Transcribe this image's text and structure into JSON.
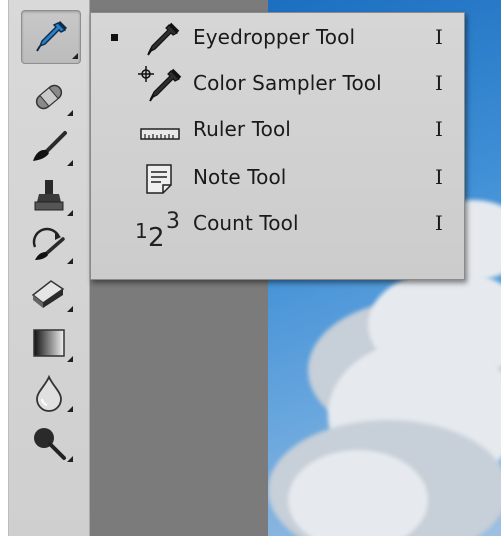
{
  "toolbar": {
    "tools": [
      {
        "name": "eyedropper-icon",
        "active": true
      },
      {
        "name": "healing-brush-icon"
      },
      {
        "name": "brush-icon"
      },
      {
        "name": "clone-stamp-icon"
      },
      {
        "name": "history-brush-icon"
      },
      {
        "name": "eraser-icon"
      },
      {
        "name": "gradient-icon"
      },
      {
        "name": "blur-drop-icon"
      },
      {
        "name": "dodge-icon"
      }
    ]
  },
  "flyout": {
    "items": [
      {
        "label": "Eyedropper Tool",
        "shortcut": "I",
        "selected": true,
        "icon": "eyedropper-icon"
      },
      {
        "label": "Color Sampler Tool",
        "shortcut": "I",
        "selected": false,
        "icon": "color-sampler-icon"
      },
      {
        "label": "Ruler Tool",
        "shortcut": "I",
        "selected": false,
        "icon": "ruler-icon"
      },
      {
        "label": "Note Tool",
        "shortcut": "I",
        "selected": false,
        "icon": "note-icon"
      },
      {
        "label": "Count Tool",
        "shortcut": "I",
        "selected": false,
        "icon": "count-icon",
        "icon_text": "123"
      }
    ]
  },
  "colors": {
    "panel": "#d6d6d6",
    "canvas_gray": "#7b7b7b",
    "sky": "#3f8fd6"
  }
}
